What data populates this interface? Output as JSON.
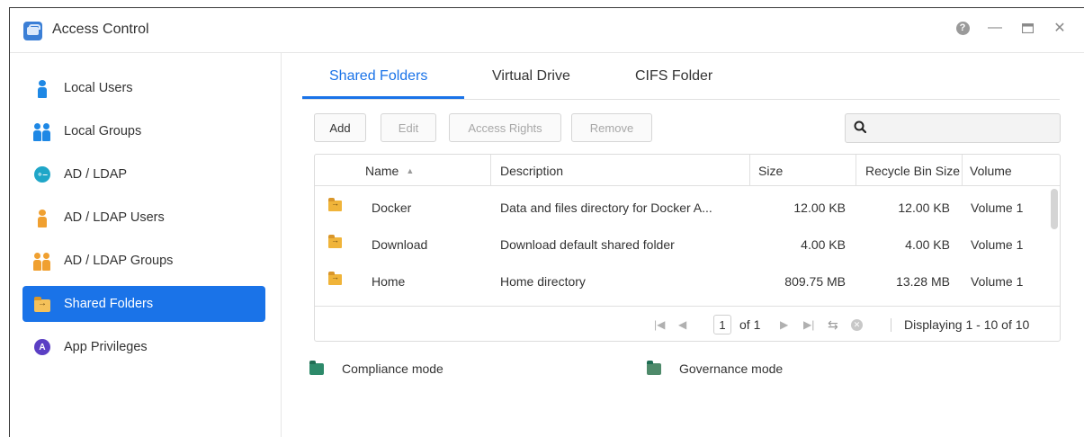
{
  "window": {
    "title": "Access Control"
  },
  "sidebar": {
    "items": [
      {
        "label": "Local Users",
        "icon": "user-icon"
      },
      {
        "label": "Local Groups",
        "icon": "group-icon"
      },
      {
        "label": "AD / LDAP",
        "icon": "key-icon"
      },
      {
        "label": "AD / LDAP Users",
        "icon": "user-icon"
      },
      {
        "label": "AD / LDAP Groups",
        "icon": "group-icon"
      },
      {
        "label": "Shared Folders",
        "icon": "folder-icon",
        "active": true
      },
      {
        "label": "App Privileges",
        "icon": "privileges-icon"
      }
    ]
  },
  "tabs": [
    {
      "label": "Shared Folders",
      "active": true
    },
    {
      "label": "Virtual Drive"
    },
    {
      "label": "CIFS Folder"
    }
  ],
  "toolbar": {
    "add": "Add",
    "edit": "Edit",
    "access_rights": "Access Rights",
    "remove": "Remove"
  },
  "search": {
    "value": ""
  },
  "table": {
    "columns": [
      "Name",
      "Description",
      "Size",
      "Recycle Bin Size",
      "Volume"
    ],
    "rows": [
      {
        "name": "Docker",
        "description": "Data and files directory for Docker A...",
        "size": "12.00 KB",
        "recycle": "12.00 KB",
        "volume": "Volume 1"
      },
      {
        "name": "Download",
        "description": "Download default shared folder",
        "size": "4.00 KB",
        "recycle": "4.00 KB",
        "volume": "Volume 1"
      },
      {
        "name": "Home",
        "description": "Home directory",
        "size": "809.75 MB",
        "recycle": "13.28 MB",
        "volume": "Volume 1"
      }
    ]
  },
  "pager": {
    "page": "1",
    "of": "of 1",
    "displaying": "Displaying 1 - 10 of 10"
  },
  "legend": {
    "compliance": "Compliance mode",
    "governance": "Governance mode"
  },
  "colors": {
    "accent": "#1a73e8",
    "folder": "#f0b43a",
    "compliance": "#2d8a6a"
  }
}
